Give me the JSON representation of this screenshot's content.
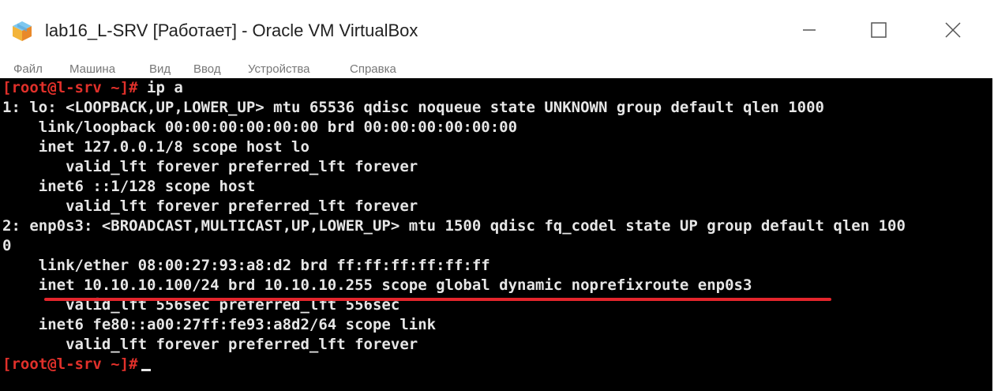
{
  "window": {
    "title": "lab16_L-SRV [Работает] - Oracle VM VirtualBox",
    "app_icon": "virtualbox-icon",
    "controls": [
      "minimize-icon",
      "maximize-icon",
      "close-icon"
    ]
  },
  "menu": {
    "items": [
      "Файл",
      "Машина",
      "Вид",
      "Ввод",
      "Устройства",
      "Справка"
    ]
  },
  "terminal": {
    "prompt": "[root@l-srv ~]#",
    "command": " ip a",
    "lines": [
      "1: lo: <LOOPBACK,UP,LOWER_UP> mtu 65536 qdisc noqueue state UNKNOWN group default qlen 1000",
      "    link/loopback 00:00:00:00:00:00 brd 00:00:00:00:00:00",
      "    inet 127.0.0.1/8 scope host lo",
      "       valid_lft forever preferred_lft forever",
      "    inet6 ::1/128 scope host",
      "       valid_lft forever preferred_lft forever",
      "2: enp0s3: <BROADCAST,MULTICAST,UP,LOWER_UP> mtu 1500 qdisc fq_codel state UP group default qlen 100",
      "0",
      "    link/ether 08:00:27:93:a8:d2 brd ff:ff:ff:ff:ff:ff",
      "    inet 10.10.10.100/24 brd 10.10.10.255 scope global dynamic noprefixroute enp0s3",
      "       valid_lft 556sec preferred_lft 556sec",
      "    inet6 fe80::a00:27ff:fe93:a8d2/64 scope link",
      "       valid_lft forever preferred_lft forever"
    ],
    "final_prompt": "[root@l-srv ~]#"
  },
  "colors": {
    "terminal_bg": "#000000",
    "terminal_text": "#e6e6e6",
    "prompt": "#e0302a",
    "highlight_underline": "#e4252c"
  }
}
